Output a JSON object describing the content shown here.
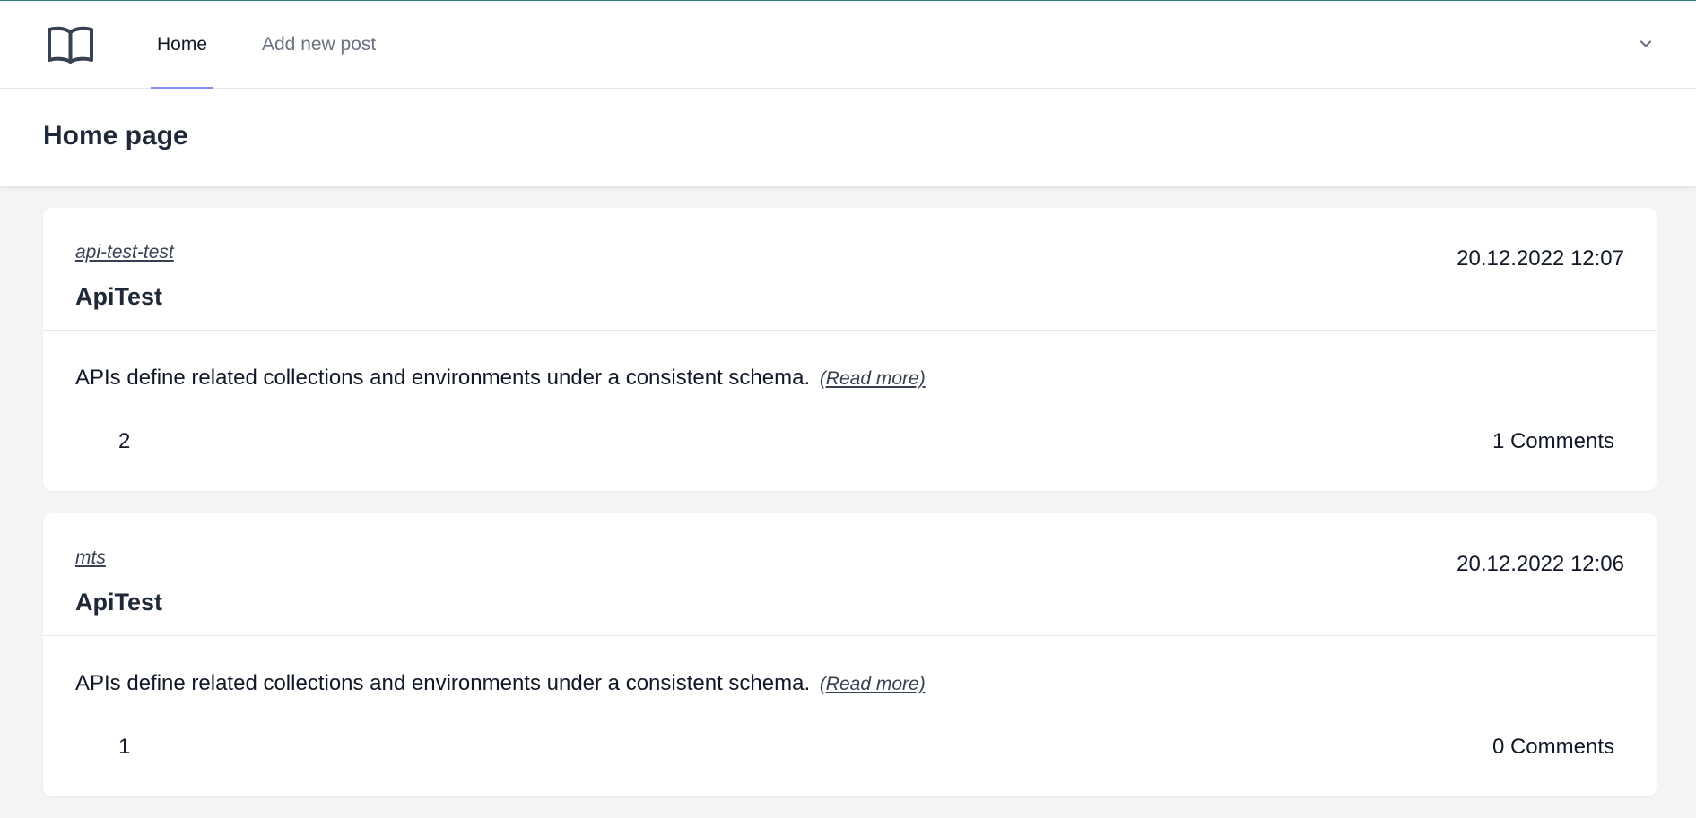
{
  "nav": {
    "logo_icon": "book-open-icon",
    "tabs": [
      {
        "label": "Home",
        "active": true
      },
      {
        "label": "Add new post",
        "active": false
      }
    ],
    "menu_icon": "chevron-down-icon"
  },
  "header": {
    "title": "Home page"
  },
  "posts": [
    {
      "author": "api-test-test",
      "date": "20.12.2022 12:07",
      "title": "ApiTest",
      "excerpt": "APIs define related collections and environments under a consistent schema.",
      "read_more": "(Read more)",
      "votes": "2",
      "comments": "1 Comments"
    },
    {
      "author": "mts",
      "date": "20.12.2022 12:06",
      "title": "ApiTest",
      "excerpt": "APIs define related collections and environments under a consistent schema.",
      "read_more": "(Read more)",
      "votes": "1",
      "comments": "0 Comments"
    }
  ],
  "colors": {
    "accent": "#818cf8",
    "background": "#f3f4f6",
    "card": "#ffffff"
  }
}
